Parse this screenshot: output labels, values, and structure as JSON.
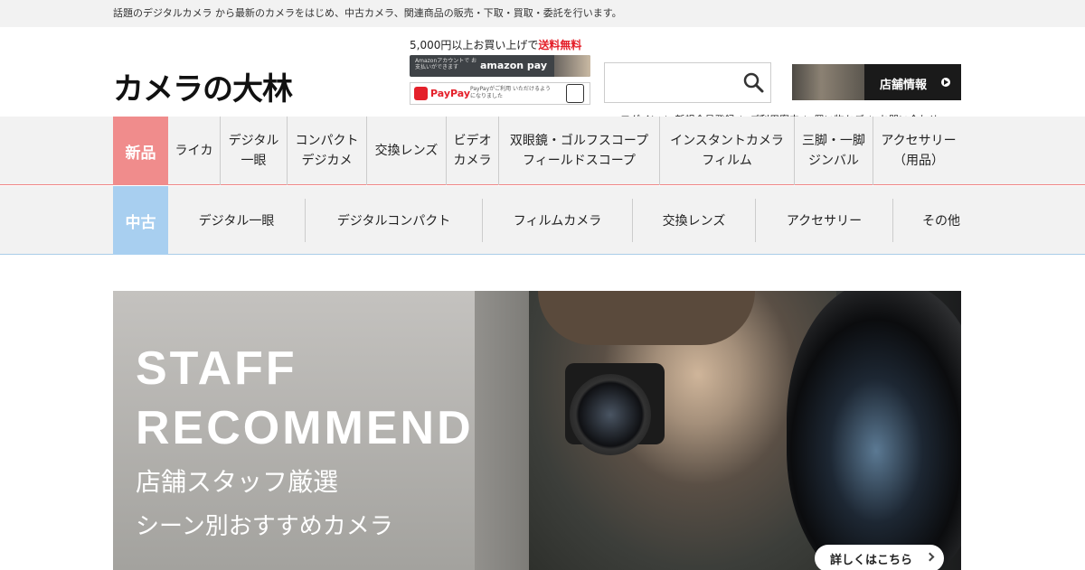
{
  "topbar": {
    "tagline": "話題のデジタルカメラ から最新のカメラをはじめ、中古カメラ、関連商品の販売・下取・買取・委託を行います。"
  },
  "header": {
    "logo": "カメラの大林",
    "shipping_prefix": "5,000円以上お買い上げで",
    "shipping_free": "送料無料",
    "amazon_small": "Amazonアカウントで お支払いができます",
    "amazon_pay": "amazon pay",
    "paypay_name": "PayPay",
    "paypay_small": "PayPayがご利用 いただけるようになりました",
    "search_placeholder": "",
    "store_label": "店舗情報",
    "util_links": [
      "ログイン",
      "新規会員登録",
      "ご利用案内",
      "買い物かご",
      "お問い合わせ"
    ]
  },
  "nav_new": {
    "badge": "新品",
    "items": [
      "ライカ",
      "デジタル\n一眼",
      "コンパクト\nデジカメ",
      "交換レンズ",
      "ビデオ\nカメラ",
      "双眼鏡・ゴルフスコープ\nフィールドスコープ",
      "インスタントカメラ\nフィルム",
      "三脚・一脚\nジンバル",
      "アクセサリー\n（用品）"
    ]
  },
  "nav_used": {
    "badge": "中古",
    "items": [
      "デジタル一眼",
      "デジタルコンパクト",
      "フィルムカメラ",
      "交換レンズ",
      "アクセサリー",
      "その他"
    ]
  },
  "hero": {
    "line1": "STAFF",
    "line2": "RECOMMEND",
    "line3": "店舗スタッフ厳選",
    "line4": "シーン別おすすめカメラ",
    "cta": "詳しくはこちら"
  }
}
